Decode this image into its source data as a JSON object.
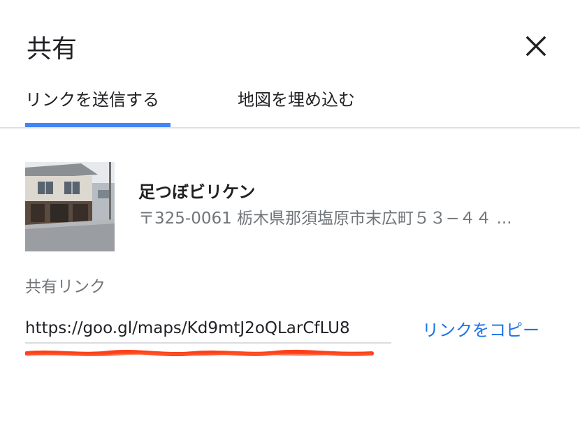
{
  "dialog": {
    "title": "共有",
    "close_icon": "close-icon"
  },
  "tabs": [
    {
      "label": "リンクを送信する",
      "active": true
    },
    {
      "label": "地図を埋め込む",
      "active": false
    }
  ],
  "place": {
    "name": "足つぼビリケン",
    "address": "〒325-0061 栃木県那須塩原市末広町５３−４４ ..."
  },
  "share": {
    "label": "共有リンク",
    "url": "https://goo.gl/maps/Kd9mtJ2oQLarCfLU8",
    "copy_label": "リンクをコピー"
  },
  "colors": {
    "accent": "#4285f4",
    "link": "#1a73e8",
    "secondary_text": "#70757a",
    "annotation": "#ff2a00"
  }
}
